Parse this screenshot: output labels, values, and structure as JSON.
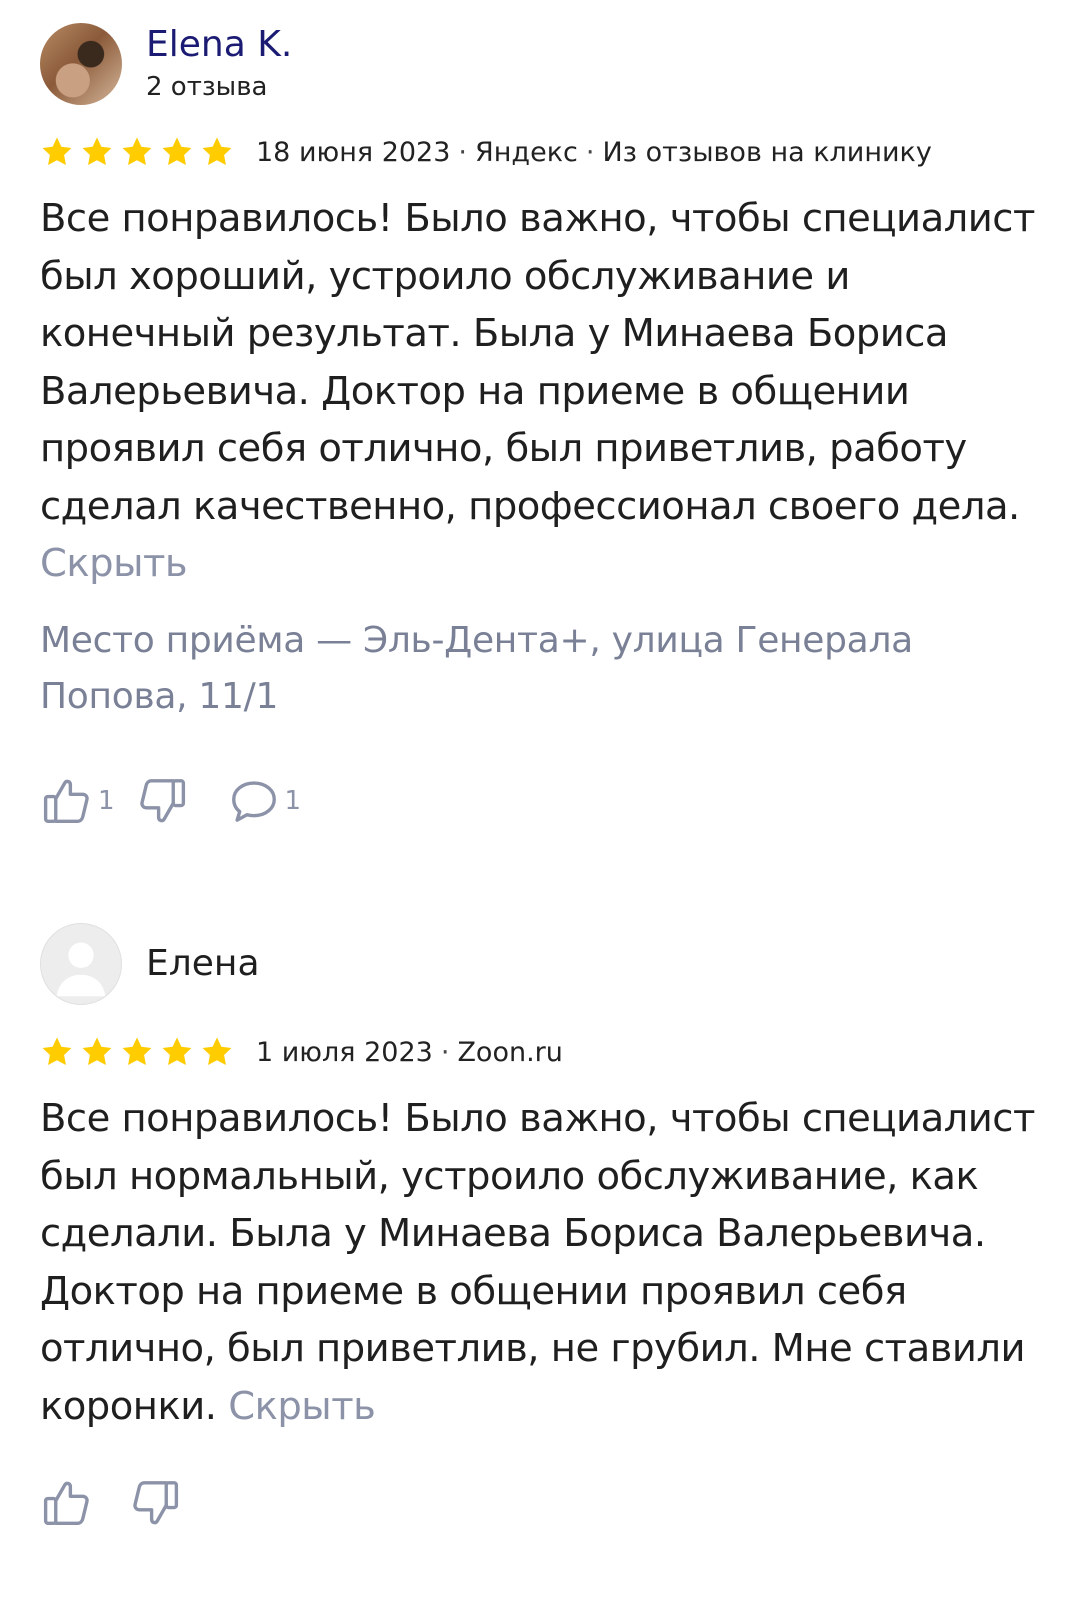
{
  "reviews": [
    {
      "author": "Elena K.",
      "reviews_count": "2 отзыва",
      "rating": 5,
      "date": "18 июня 2023",
      "source": "Яндекс",
      "source_note": "Из отзывов на клинику",
      "text": "Все понравилось! Было важно, чтобы специалист был хороший, устроило обслуживание и конечный результат. Была у Минаева Бориса Валерьевича. Доктор на приеме в общении проявил себя отлично, был приветлив, работу сделал качественно, профессионал своего дела.",
      "hide_label": "Скрыть",
      "place": "Место приёма — Эль-Дента+, улица Генерала Попова, 11/1",
      "likes": "1",
      "comments": "1"
    },
    {
      "author": "Елена",
      "rating": 5,
      "date": "1 июля 2023",
      "source": "Zoon.ru",
      "text": "Все понравилось! Было важно, чтобы специалист был нормальный, устроило обслуживание, как сделали. Была у Минаева Бориса Валерьевича. Доктор на приеме в общении проявил себя отлично, был приветлив, не грубил. Мне ставили коронки.",
      "hide_label": "Скрыть"
    }
  ],
  "dot": "·",
  "colors": {
    "star": "#FFCC00",
    "author_link": "#1B1B73",
    "muted": "#8C93A8"
  },
  "icons": [
    "like-icon",
    "dislike-icon",
    "comment-icon",
    "star-icon"
  ]
}
